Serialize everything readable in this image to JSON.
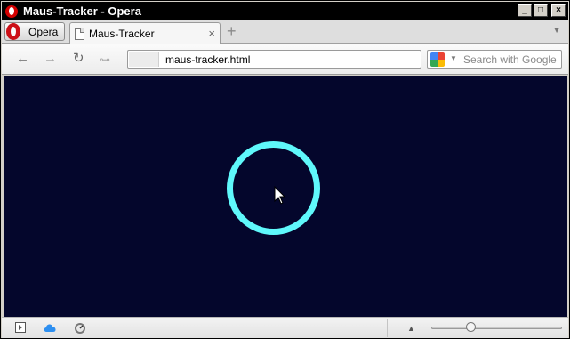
{
  "window": {
    "title": "Maus-Tracker - Opera"
  },
  "menu": {
    "label": "Opera"
  },
  "tabs": [
    {
      "title": "Maus-Tracker",
      "active": true
    }
  ],
  "address_bar": {
    "url": "maus-tracker.html"
  },
  "search": {
    "placeholder": "Search with Google"
  },
  "icons": {
    "opera_logo": "opera-logo",
    "page_icon": "document-icon",
    "close_tab": "close-icon",
    "new_tab": "plus-icon",
    "back": "arrow-left-icon",
    "forward": "arrow-right-icon",
    "reload": "reload-icon",
    "key": "key-icon",
    "search_engine": "google-icon",
    "panel": "panel-toggle-icon",
    "sync": "cloud-icon",
    "speed": "speedometer-icon",
    "cursor": "mouse-cursor-icon"
  },
  "glyphs": {
    "close": "×",
    "new_tab": "+",
    "back": "←",
    "forward": "→",
    "reload": "↻",
    "key": "⊶",
    "dropdown": "▼",
    "tab_menu": "▼",
    "up": "▲",
    "minimize": "_",
    "maximize": "□",
    "close_window": "×"
  },
  "colors": {
    "page_background": "#04062c",
    "ring": "#5ff8fb",
    "title_bar": "#000000",
    "opera_red": "#cc0f16"
  },
  "zoom": {
    "level_fraction": 0.3
  }
}
